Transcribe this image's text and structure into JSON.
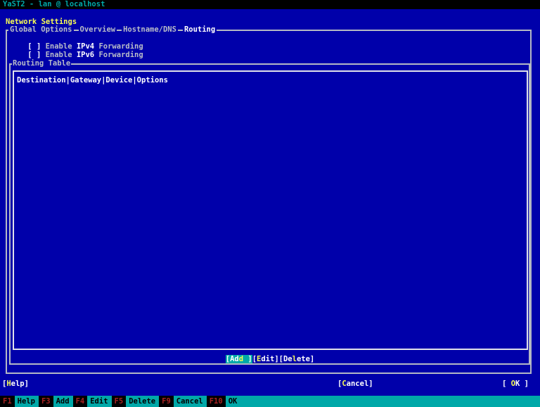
{
  "title_bar": {
    "text": "YaST2 - lan @ localhost"
  },
  "heading": "Network Settings",
  "tabs": {
    "items": [
      {
        "label": "Global Options",
        "active": false
      },
      {
        "label": "Overview",
        "active": false
      },
      {
        "label": "Hostname/DNS",
        "active": false
      },
      {
        "label": "Routing",
        "active": true
      }
    ]
  },
  "checkboxes": {
    "ipv4": {
      "box": "[ ]",
      "label_pre": " Enable ",
      "label_strong": "IPv4",
      "label_post": " Forwarding",
      "checked": false
    },
    "ipv6": {
      "box": "[ ]",
      "label_pre": " Enable ",
      "label_strong": "IPv6",
      "label_post": " Forwarding",
      "checked": false
    }
  },
  "routing_frame": {
    "label": "Routing Table"
  },
  "table": {
    "columns": [
      "Destination",
      "Gateway",
      "Device",
      "Options"
    ],
    "header_text": "Destination|Gateway|Device|Options",
    "rows": []
  },
  "buttons": {
    "add": {
      "pre": "[Ad",
      "hot": "d",
      "post": " ]",
      "focused": true
    },
    "edit": {
      "pre": "[",
      "hot": "E",
      "post": "dit]",
      "focused": false
    },
    "delete": {
      "pre": "[De",
      "hot": "l",
      "post": "ete]",
      "focused": false
    }
  },
  "footer": {
    "help": {
      "pre": "[",
      "hot": "H",
      "post": "elp]"
    },
    "cancel": {
      "pre": "[",
      "hot": "C",
      "post": "ancel]"
    },
    "ok": {
      "pre": "[ ",
      "hot": "O",
      "post": "K ]"
    }
  },
  "fkeys": [
    {
      "key": "F1",
      "label": "Help"
    },
    {
      "key": "F3",
      "label": "Add"
    },
    {
      "key": "F4",
      "label": "Edit"
    },
    {
      "key": "F5",
      "label": "Delete"
    },
    {
      "key": "F9",
      "label": "Cancel"
    },
    {
      "key": "F10",
      "label": "OK"
    }
  ],
  "colors": {
    "background": "#0000aa",
    "titlebar_bg": "#000000",
    "accent_teal": "#00a8a8",
    "text_normal": "#b8bcc8",
    "text_bright": "#ffffff",
    "hotkey_yellow": "#f8fc54",
    "fkey_red": "#a82222",
    "border_frame": "#b4b8c4",
    "border_table": "#e0e2ea"
  }
}
